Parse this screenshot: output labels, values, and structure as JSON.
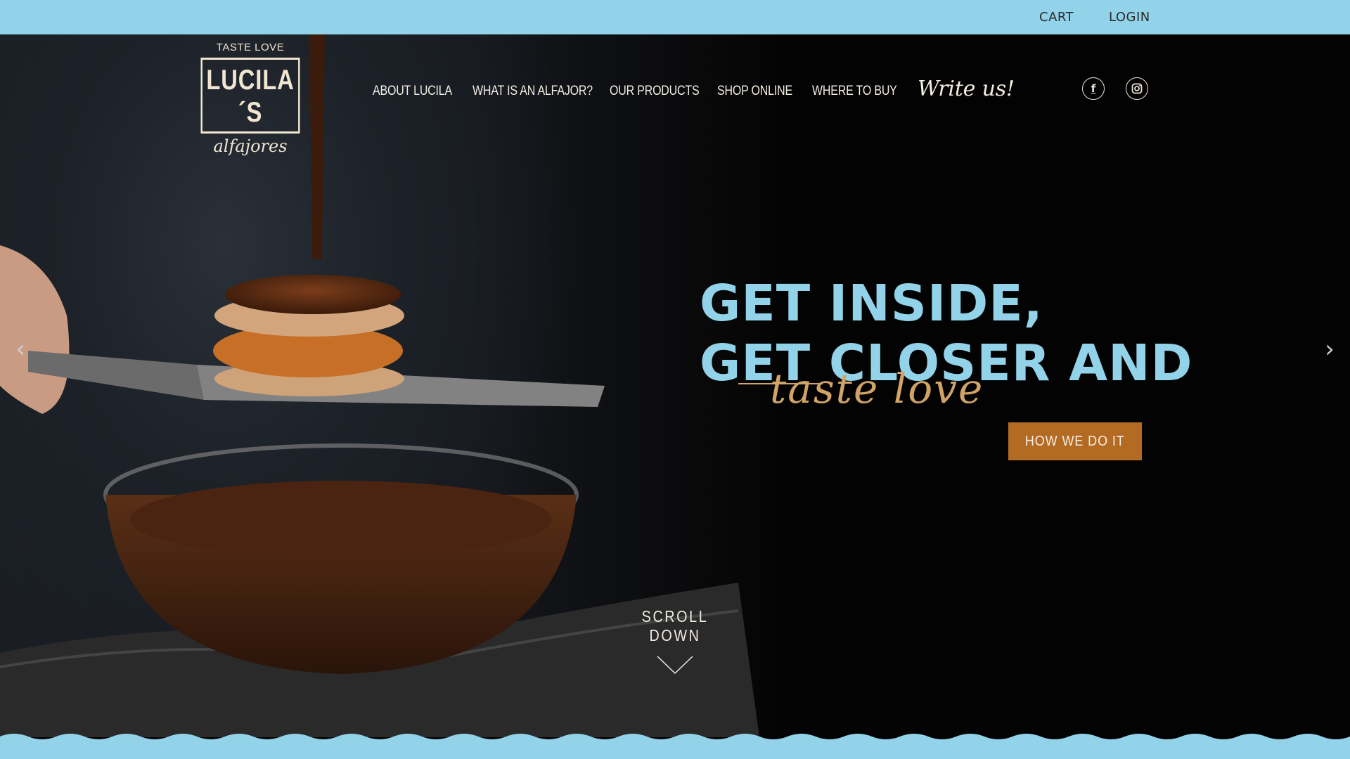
{
  "topbar": {
    "cart": "CART",
    "login": "LOGIN"
  },
  "logo": {
    "tagline": "TASTE LOVE",
    "name": "LUCILA´S",
    "subtitle": "alfajores"
  },
  "nav": {
    "items": [
      {
        "label": "ABOUT LUCILA"
      },
      {
        "label": "WHAT IS AN ALFAJOR?"
      },
      {
        "label": "OUR PRODUCTS"
      },
      {
        "label": "SHOP ONLINE"
      },
      {
        "label": "WHERE TO BUY"
      }
    ],
    "write_us": "Write us!"
  },
  "social": {
    "facebook_icon": "facebook-icon",
    "instagram_icon": "instagram-icon"
  },
  "hero": {
    "headline_line1": "GET INSIDE,",
    "headline_line2": "GET CLOSER AND",
    "tagline": "taste love",
    "cta": "HOW WE DO IT",
    "scroll": "SCROLL DOWN"
  },
  "colors": {
    "topbar": "#92d3ea",
    "headline": "#92d3ea",
    "accent": "#b36b24",
    "tagline": "#d1a366",
    "background": "#050404"
  }
}
